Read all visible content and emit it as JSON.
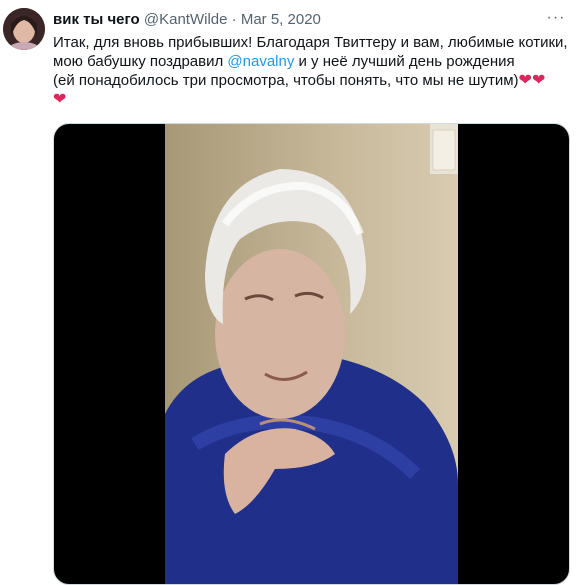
{
  "tweet": {
    "author_name": "вик ты чего",
    "author_handle": "@KantWilde",
    "separator": "·",
    "date": "Mar 5, 2020",
    "more_label": "···",
    "text_line_1": "Итак, для вновь прибывших! Благодаря Твиттеру и вам, любимые котики,",
    "text_line_2_before": "мою бабушку поздравил ",
    "mention": "@navalny",
    "text_line_2_after": " и у неё лучший день рождения",
    "text_line_3": "(ей понадобилось три просмотра, чтобы понять, что мы не шутим)",
    "hearts_line_3": "❤❤",
    "hearts_line_4": "❤"
  },
  "colors": {
    "mention": "#1d9bf0",
    "heart": "#e0245e",
    "meta": "#536471",
    "text": "#0f1419"
  },
  "icons": {
    "more": "more-icon",
    "heart": "heart-emoji"
  }
}
